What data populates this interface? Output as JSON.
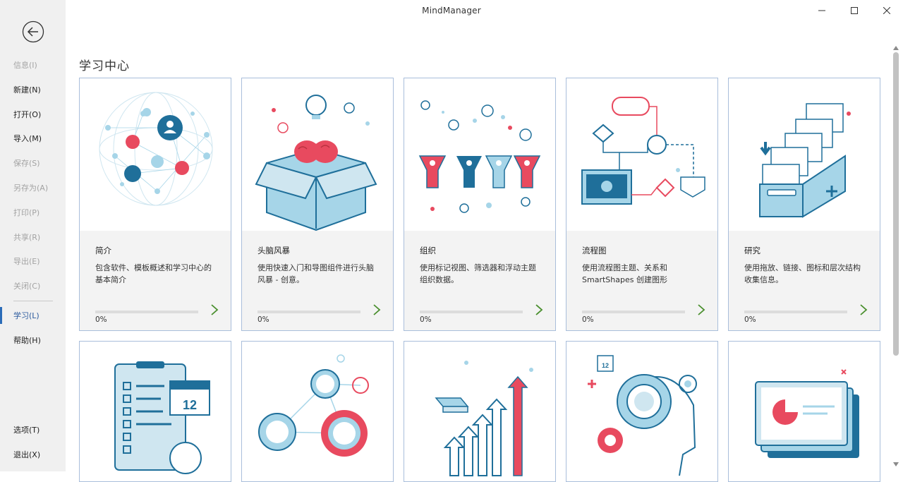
{
  "window": {
    "title": "MindManager"
  },
  "sidebar": {
    "back_label": "back",
    "items": [
      {
        "label": "信息(I)",
        "state": "disabled"
      },
      {
        "label": "新建(N)",
        "state": "enabled"
      },
      {
        "label": "打开(O)",
        "state": "enabled"
      },
      {
        "label": "导入(M)",
        "state": "enabled"
      },
      {
        "label": "保存(S)",
        "state": "disabled"
      },
      {
        "label": "另存为(A)",
        "state": "disabled"
      },
      {
        "label": "打印(P)",
        "state": "disabled"
      },
      {
        "label": "共享(R)",
        "state": "disabled"
      },
      {
        "label": "导出(E)",
        "state": "disabled"
      },
      {
        "label": "关闭(C)",
        "state": "disabled"
      },
      {
        "label": "学习(L)",
        "state": "active"
      },
      {
        "label": "帮助(H)",
        "state": "enabled"
      }
    ],
    "bottom_items": [
      {
        "label": "选项(T)"
      },
      {
        "label": "退出(X)"
      }
    ]
  },
  "main": {
    "title": "学习中心",
    "cards": [
      {
        "title": "简介",
        "desc": "包含软件、模板概述和学习中心的基本简介",
        "progress": 0,
        "progress_label": "0%",
        "icon": "globe-network-icon"
      },
      {
        "title": "头脑风暴",
        "desc": "使用快速入门和导图组件进行头脑风暴 - 创意。",
        "progress": 0,
        "progress_label": "0%",
        "icon": "brain-box-icon"
      },
      {
        "title": "组织",
        "desc": "使用标记视图、筛选器和浮动主题组织数据。",
        "progress": 0,
        "progress_label": "0%",
        "icon": "funnels-icon"
      },
      {
        "title": "流程图",
        "desc": "使用流程图主题、关系和 SmartShapes 创建图形",
        "progress": 0,
        "progress_label": "0%",
        "icon": "flowchart-icon"
      },
      {
        "title": "研究",
        "desc": "使用拖放、链接、图标和层次结构收集信息。",
        "progress": 0,
        "progress_label": "0%",
        "icon": "file-box-icon"
      }
    ],
    "cards_row2": [
      {
        "icon": "clipboard-calendar-icon",
        "calendar_day": "12"
      },
      {
        "icon": "people-network-icon"
      },
      {
        "icon": "growth-arrows-icon"
      },
      {
        "icon": "gear-head-icon",
        "calendar_day": "12"
      },
      {
        "icon": "presentation-slides-icon"
      }
    ]
  },
  "colors": {
    "accent": "#2b6cb8",
    "card_border": "#a9bedb",
    "brand_blue": "#1f6f9a",
    "brand_red": "#e84a5f",
    "light_blue": "#a6d5e8",
    "progress_green": "#4a8f2e"
  }
}
